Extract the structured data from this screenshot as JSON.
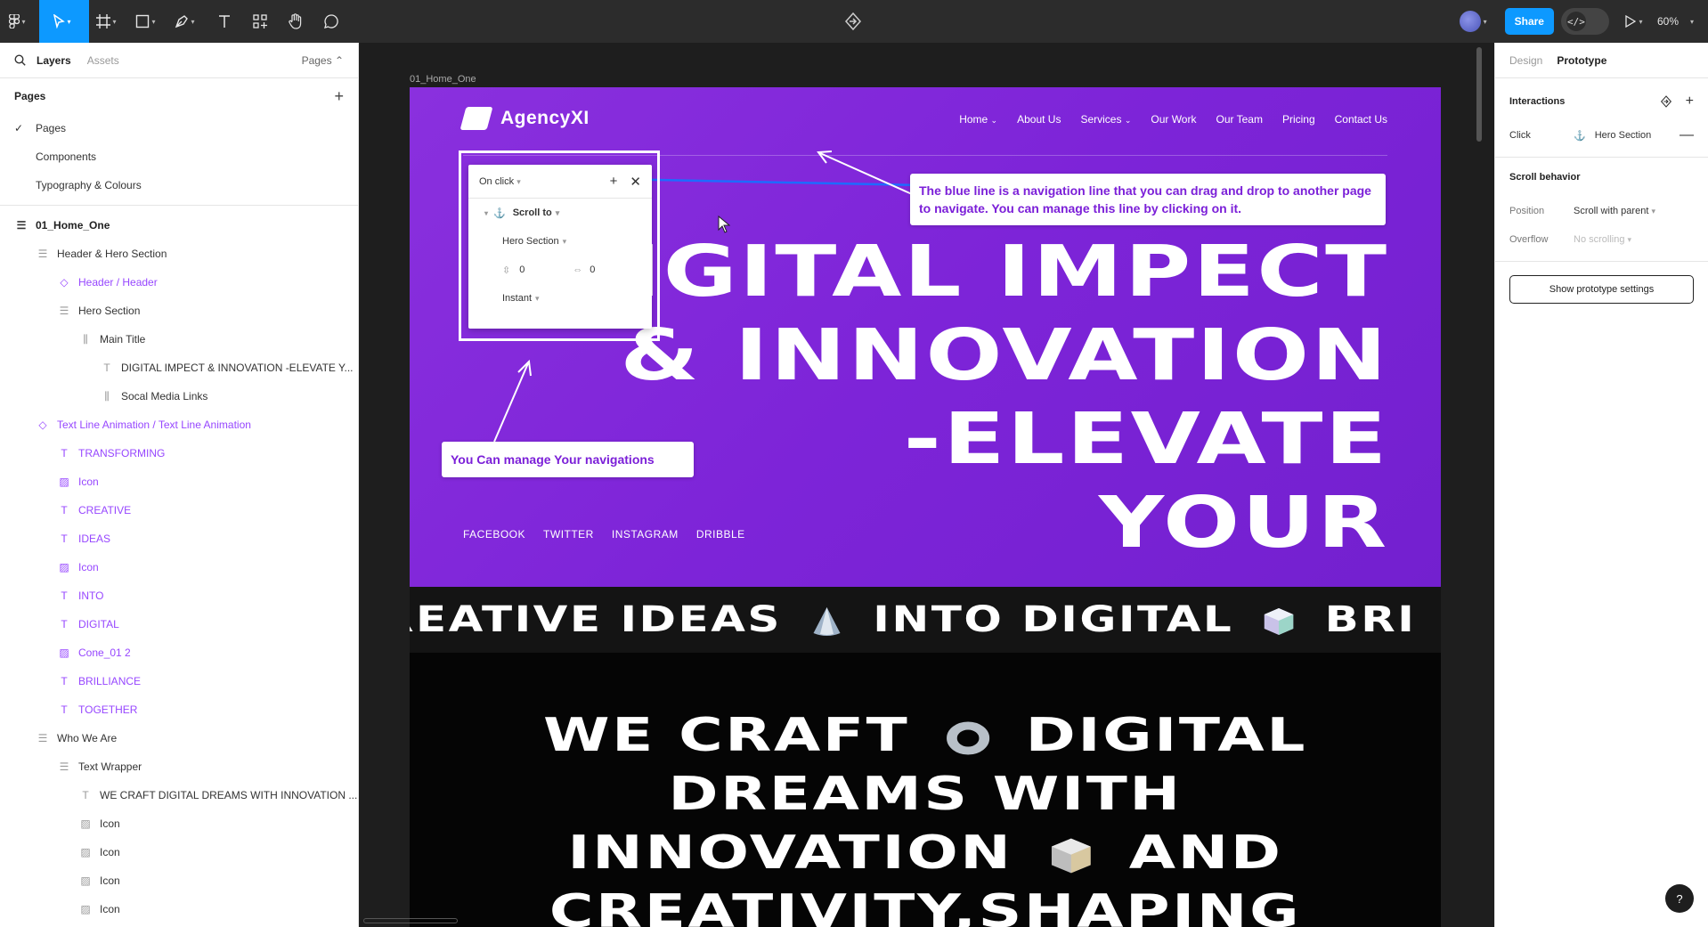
{
  "toolbar": {
    "zoom": "60%",
    "share_label": "Share",
    "dev_mode_icon": "</>"
  },
  "left_panel": {
    "tabs": [
      "Layers",
      "Assets"
    ],
    "pages_dropdown": "Pages ⌃",
    "pages_heading": "Pages",
    "pages": [
      "Pages",
      "Components",
      "Typography & Colours"
    ],
    "layers": [
      {
        "label": "01_Home_One",
        "icon": "frame-icon"
      },
      {
        "label": "Header & Hero Section",
        "icon": "auto-layout-icon"
      },
      {
        "label": "Header / Header",
        "icon": "component-instance-icon"
      },
      {
        "label": "Hero Section",
        "icon": "auto-layout-icon"
      },
      {
        "label": "Main Title",
        "icon": "auto-layout-horizontal-icon"
      },
      {
        "label": "DIGITAL IMPECT & INNOVATION -ELEVATE Y...",
        "icon": "text-icon"
      },
      {
        "label": "Socal Media Links",
        "icon": "auto-layout-horizontal-icon"
      },
      {
        "label": "Text Line Animation / Text Line Animation",
        "icon": "component-instance-icon"
      },
      {
        "label": "TRANSFORMING",
        "icon": "text-icon"
      },
      {
        "label": "Icon",
        "icon": "image-icon"
      },
      {
        "label": "CREATIVE",
        "icon": "text-icon"
      },
      {
        "label": "IDEAS",
        "icon": "text-icon"
      },
      {
        "label": "Icon",
        "icon": "image-icon"
      },
      {
        "label": "INTO",
        "icon": "text-icon"
      },
      {
        "label": "DIGITAL",
        "icon": "text-icon"
      },
      {
        "label": "Cone_01 2",
        "icon": "image-icon"
      },
      {
        "label": "BRILLIANCE",
        "icon": "text-icon"
      },
      {
        "label": "TOGETHER",
        "icon": "text-icon"
      },
      {
        "label": "Who We Are",
        "icon": "auto-layout-icon"
      },
      {
        "label": "Text Wrapper",
        "icon": "auto-layout-icon"
      },
      {
        "label": "WE CRAFT DIGITAL DREAMS WITH INNOVATION ...",
        "icon": "text-icon"
      },
      {
        "label": "Icon",
        "icon": "image-icon"
      },
      {
        "label": "Icon",
        "icon": "image-icon"
      },
      {
        "label": "Icon",
        "icon": "image-icon"
      },
      {
        "label": "Icon",
        "icon": "image-icon"
      }
    ]
  },
  "canvas": {
    "frame_label": "01_Home_One",
    "logo": "AgencyXI",
    "nav": [
      "Home",
      "About Us",
      "Services",
      "Our Work",
      "Our Team",
      "Pricing",
      "Contact Us"
    ],
    "hero_lines": [
      "DIGITAL IMPECT",
      "& INNOVATION",
      "-ELEVATE",
      "YOUR"
    ],
    "socials": [
      "FACEBOOK",
      "TWITTER",
      "INSTAGRAM",
      "DRIBBLE"
    ],
    "marquee_words": [
      "REATIVE IDEAS",
      "INTO DIGITAL",
      "BRI"
    ],
    "craft_lines": [
      "WE CRAFT",
      "DIGITAL",
      "DREAMS WITH",
      "INNOVATION",
      "AND",
      "CREATIVITY,SHAPING"
    ],
    "interaction_popover": {
      "trigger": "On click",
      "action": "Scroll to",
      "destination": "Hero Section",
      "offset_y": "0",
      "offset_x": "0",
      "animation": "Instant"
    },
    "callout_navigation_line": "The blue line is a navigation line that you can drag and drop to another page to navigate. You can manage this line by clicking on it.",
    "callout_manage": "You Can manage Your navigations",
    "accent_color": "#7d24d8",
    "connector_color": "#1e6bff"
  },
  "right_panel": {
    "tabs": [
      "Design",
      "Prototype"
    ],
    "interactions_heading": "Interactions",
    "interaction": {
      "trigger": "Click",
      "destination": "Hero Section"
    },
    "scroll_heading": "Scroll behavior",
    "position_label": "Position",
    "position_value": "Scroll with parent",
    "overflow_label": "Overflow",
    "overflow_value": "No scrolling",
    "prototype_settings": "Show prototype settings",
    "help": "?"
  }
}
